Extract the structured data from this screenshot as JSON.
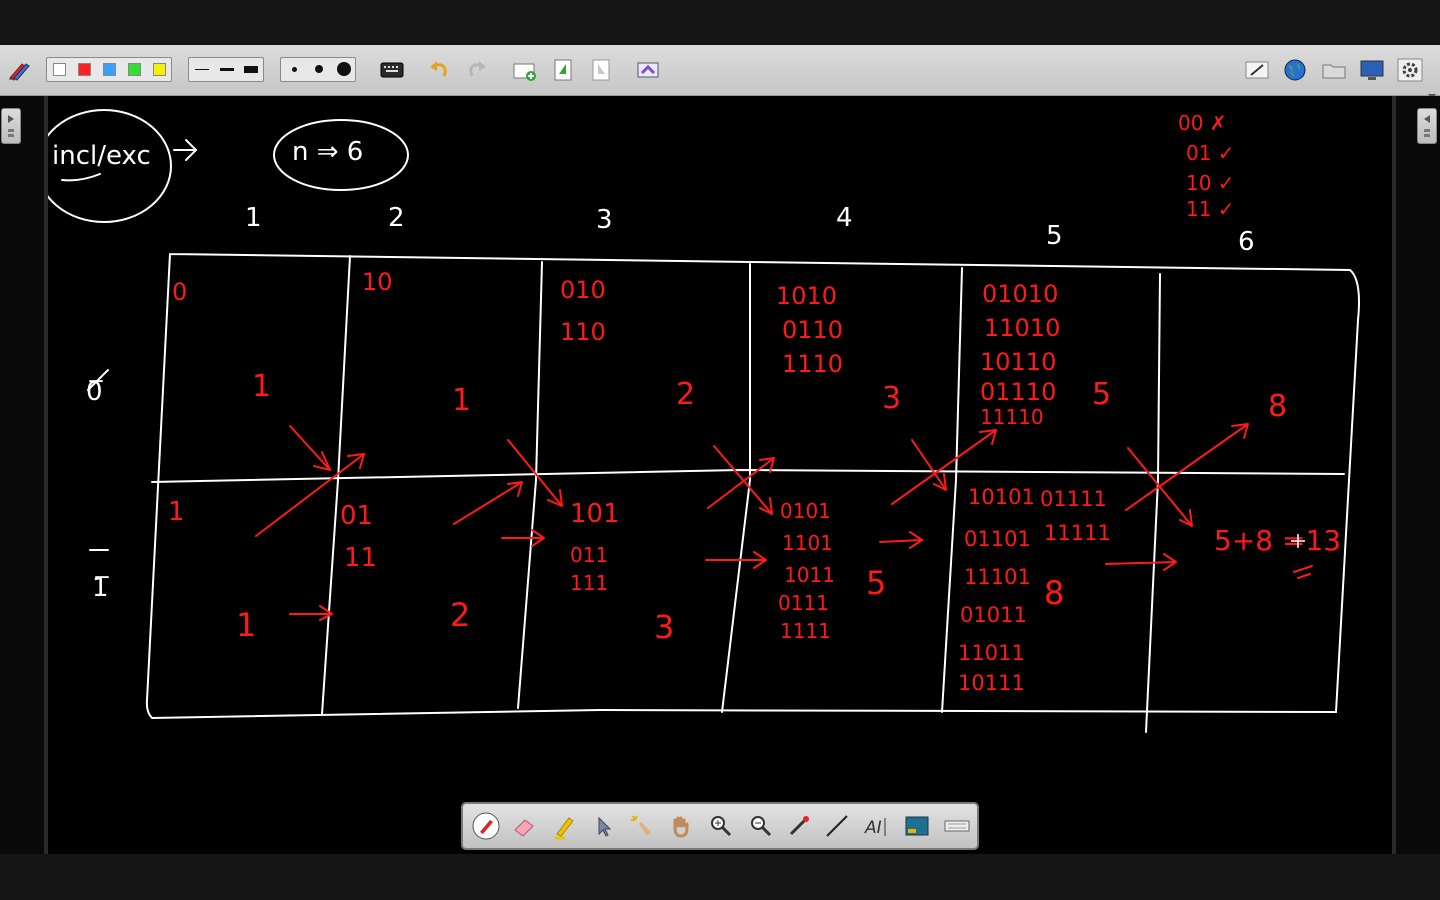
{
  "colors": {
    "ink_white": "#ffffff",
    "ink_red": "#ff1a1a",
    "toolbar_bg": "#cfcfcf",
    "canvas_bg": "#000000"
  },
  "toolbar": {
    "pen_color_swatches": [
      "#ffffff",
      "#ff2020",
      "#3aa0ff",
      "#33dd33",
      "#f2f200"
    ],
    "line_widths": [
      "thin",
      "medium",
      "thick"
    ],
    "dot_sizes": [
      "small",
      "medium",
      "large"
    ],
    "icons_left": [
      "pen-settings-icon",
      "keyboard-icon",
      "undo-icon",
      "redo-icon",
      "new-page-icon",
      "next-page-icon",
      "previous-page-icon",
      "screen-capture-icon"
    ],
    "icons_right": [
      "edit-mode-icon",
      "internet-icon",
      "folder-icon",
      "display-icon",
      "settings-icon"
    ]
  },
  "palette": {
    "tools": [
      "pen-tool",
      "eraser-tool",
      "highlighter-tool",
      "select-arrow-tool",
      "magic-pointer-tool",
      "pan-hand-tool",
      "zoom-in-tool",
      "zoom-out-tool",
      "laser-pen-tool",
      "line-tool",
      "text-tool",
      "background-tool",
      "onscreen-keyboard-tool"
    ]
  },
  "board": {
    "circled_notes": [
      "incl/exc",
      "n ⇒ 6"
    ],
    "column_headers": [
      "1",
      "2",
      "3",
      "4",
      "5",
      "6"
    ],
    "row_labels": [
      "0̅",
      "1̅"
    ],
    "checklist": [
      "00 ✗",
      "01 ✓",
      "10 ✓",
      "11 ✓"
    ],
    "row0_cells": [
      {
        "strings": [
          "0"
        ],
        "count": "1"
      },
      {
        "strings": [
          "10"
        ],
        "count": "1"
      },
      {
        "strings": [
          "010",
          "110"
        ],
        "count": "2"
      },
      {
        "strings": [
          "1010",
          "0110",
          "1110"
        ],
        "count": "3"
      },
      {
        "strings": [
          "01010",
          "11010",
          "10110",
          "01110",
          "11110"
        ],
        "count": "5"
      },
      {
        "strings": [],
        "count": "8"
      }
    ],
    "row1_cells": [
      {
        "strings": [
          "1"
        ],
        "count": "1"
      },
      {
        "strings": [
          "01",
          "11"
        ],
        "count": "2"
      },
      {
        "strings": [
          "101",
          "011",
          "111"
        ],
        "count": "3"
      },
      {
        "strings": [
          "0101",
          "1101",
          "1011",
          "0111",
          "1111"
        ],
        "count": "5"
      },
      {
        "strings": [
          "10101",
          "01101",
          "11101",
          "01011",
          "11011",
          "10111",
          "01111",
          "11111"
        ],
        "count": "8"
      },
      {
        "strings": [],
        "count": "5+8 =13"
      }
    ]
  }
}
